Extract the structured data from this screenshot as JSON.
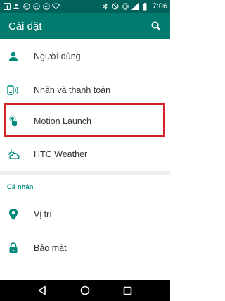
{
  "status_bar": {
    "time": "7:06",
    "left_icons": [
      "facebook-icon",
      "person-notification-icon",
      "messenger-icon",
      "messenger-icon",
      "messenger-icon",
      "wifi-icon"
    ],
    "right_icons": [
      "bluetooth-icon",
      "do-not-disturb-icon",
      "vibrate-icon",
      "signal-icon",
      "battery-icon"
    ]
  },
  "app_bar": {
    "title": "Cài đặt",
    "search_icon": "search-icon"
  },
  "items": [
    {
      "label": "Người dùng",
      "icon": "person-icon"
    },
    {
      "label": "Nhấn và thanh toán",
      "icon": "tap-pay-icon"
    },
    {
      "label": "Motion Launch",
      "icon": "touch-icon"
    },
    {
      "label": "HTC Weather",
      "icon": "weather-icon"
    }
  ],
  "section_personal": {
    "header": "Cá nhân",
    "items": [
      {
        "label": "Vị trí",
        "icon": "location-icon"
      },
      {
        "label": "Bảo mật",
        "icon": "lock-icon"
      }
    ]
  },
  "colors": {
    "status_bar": "#00625a",
    "app_bar": "#007b6e",
    "accent": "#00897b",
    "highlight_border": "#d42027"
  },
  "nav_bar": {
    "buttons": [
      "back-icon",
      "home-icon",
      "recents-icon"
    ]
  }
}
